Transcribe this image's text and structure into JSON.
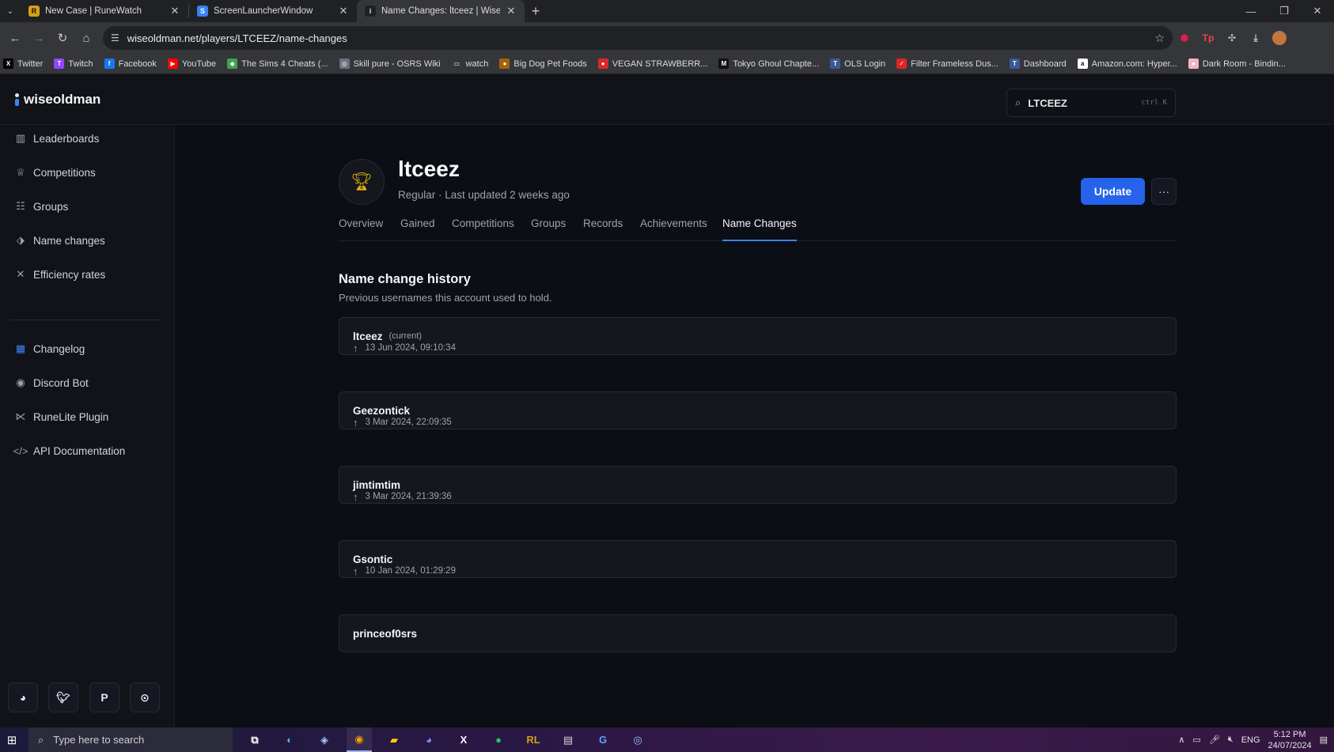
{
  "browser": {
    "tabs": [
      {
        "title": "New Case | RuneWatch",
        "favicon": "runewatch-icon",
        "color": "#d4a017",
        "glyph": "R"
      },
      {
        "title": "ScreenLauncherWindow",
        "favicon": "window-icon",
        "color": "#3b82f6",
        "glyph": "S"
      },
      {
        "title": "Name Changes: ltceez | Wise Ol",
        "favicon": "wiseoldman-icon",
        "color": "#e5e7eb",
        "glyph": "i",
        "active": true
      }
    ],
    "url": "wiseoldman.net/players/LTCEEZ/name-changes",
    "bookmarks": [
      {
        "label": "Twitter",
        "color": "#000000",
        "glyph": "X"
      },
      {
        "label": "Twitch",
        "color": "#9146ff",
        "glyph": "T"
      },
      {
        "label": "Facebook",
        "color": "#1877f2",
        "glyph": "f"
      },
      {
        "label": "YouTube",
        "color": "#ff0000",
        "glyph": "▶"
      },
      {
        "label": "The Sims 4 Cheats (...",
        "color": "#3fa34d",
        "glyph": "◆"
      },
      {
        "label": "Skill pure - OSRS Wiki",
        "color": "#6b7280",
        "glyph": "◎"
      },
      {
        "label": "watch",
        "color": "#35363a",
        "glyph": "▭"
      },
      {
        "label": "Big Dog Pet Foods",
        "color": "#a16207",
        "glyph": "●"
      },
      {
        "label": "VEGAN STRAWBERR...",
        "color": "#dc2626",
        "glyph": "●"
      },
      {
        "label": "Tokyo Ghoul Chapte...",
        "color": "#111111",
        "glyph": "M"
      },
      {
        "label": "OLS Login",
        "color": "#3b5998",
        "glyph": "T"
      },
      {
        "label": "Filter Frameless Dus...",
        "color": "#dc2626",
        "glyph": "✓"
      },
      {
        "label": "Dashboard",
        "color": "#3b5998",
        "glyph": "T"
      },
      {
        "label": "Amazon.com: Hyper...",
        "color": "#ffffff",
        "glyph": "a"
      },
      {
        "label": "Dark Room - Bindin...",
        "color": "#f3b4c4",
        "glyph": "●"
      }
    ]
  },
  "app": {
    "brand": "wiseoldman",
    "search": {
      "value": "LTCEEZ",
      "shortcut": "ctrl K"
    },
    "sidebar": {
      "primary": [
        {
          "label": "Leaderboards",
          "icon": "bar-chart-icon"
        },
        {
          "label": "Competitions",
          "icon": "trophy-icon"
        },
        {
          "label": "Groups",
          "icon": "users-icon"
        },
        {
          "label": "Name changes",
          "icon": "tag-icon"
        },
        {
          "label": "Efficiency rates",
          "icon": "tools-icon"
        }
      ],
      "secondary": [
        {
          "label": "Changelog",
          "icon": "changelog-icon"
        },
        {
          "label": "Discord Bot",
          "icon": "discord-icon"
        },
        {
          "label": "RuneLite Plugin",
          "icon": "runelite-icon"
        },
        {
          "label": "API Documentation",
          "icon": "code-icon"
        }
      ]
    },
    "player": {
      "name": "ltceez",
      "subtitle": "Regular · Last updated 2 weeks ago",
      "update_label": "Update",
      "more_label": "···"
    },
    "tabs": [
      "Overview",
      "Gained",
      "Competitions",
      "Groups",
      "Records",
      "Achievements",
      "Name Changes"
    ],
    "active_tab": "Name Changes",
    "history": {
      "title": "Name change history",
      "description": "Previous usernames this account used to hold.",
      "names": [
        "ltceez",
        "Geezontick",
        "jimtimtim",
        "Gsontic",
        "princeof0srs"
      ],
      "current_label": "(current)",
      "dates": [
        "13 Jun 2024, 09:10:34",
        "3 Mar 2024, 22:09:35",
        "3 Mar 2024, 21:39:36",
        "10 Jan 2024, 01:29:29"
      ]
    }
  },
  "taskbar": {
    "search_placeholder": "Type here to search",
    "time": "5:12 PM",
    "date": "24/07/2024",
    "language": "ENG"
  },
  "colors": {
    "accent": "#2563eb",
    "active_tab_underline": "#3b82f6"
  }
}
